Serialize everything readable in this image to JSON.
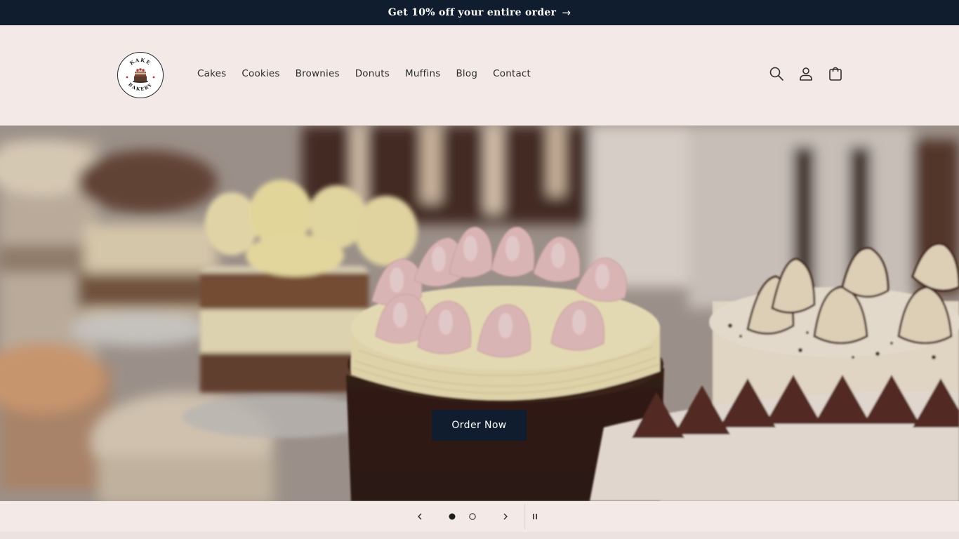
{
  "announcement": {
    "text": "Get 10% off your entire order",
    "arrow": "→"
  },
  "header": {
    "logo": {
      "top_text": "KAKE",
      "bottom_text": "BAKERY"
    },
    "nav": [
      {
        "label": "Cakes"
      },
      {
        "label": "Cookies"
      },
      {
        "label": "Brownies"
      },
      {
        "label": "Donuts"
      },
      {
        "label": "Muffins"
      },
      {
        "label": "Blog"
      },
      {
        "label": "Contact"
      }
    ],
    "icons": [
      "search-icon",
      "account-icon",
      "cart-icon"
    ]
  },
  "hero": {
    "button_label": "Order Now"
  },
  "slider": {
    "slide_count": 2,
    "active_slide": 1,
    "icons": [
      "chevron-left-icon",
      "chevron-right-icon",
      "pause-icon"
    ]
  },
  "colors": {
    "announcement_bg": "#0f1d2e",
    "page_bg": "#f3e9e6",
    "button_bg": "#0f1d2e",
    "text": "#2d2d2d"
  }
}
